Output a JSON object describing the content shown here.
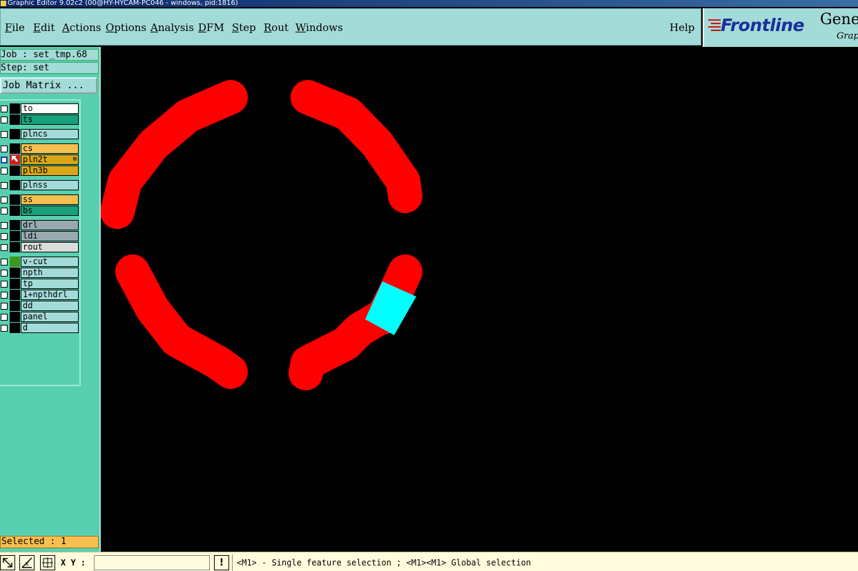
{
  "window": {
    "title": "Graphic Editor 9.02c2 (00@HY-HYCAM-PC046 - windows, pid:1816)"
  },
  "menubar": {
    "items": [
      {
        "key": "file",
        "label": "File",
        "u": "F",
        "rest": "ile"
      },
      {
        "key": "edit",
        "label": "Edit",
        "u": "E",
        "rest": "dit"
      },
      {
        "key": "actions",
        "label": "Actions",
        "u": "A",
        "rest": "ctions"
      },
      {
        "key": "options",
        "label": "Options",
        "u": "O",
        "rest": "ptions"
      },
      {
        "key": "analysis",
        "label": "Analysis",
        "u": "A",
        "rest": "nalysis"
      },
      {
        "key": "dfm",
        "label": "DFM",
        "u": "D",
        "rest": "FM"
      },
      {
        "key": "step",
        "label": "Step",
        "u": "S",
        "rest": "tep"
      },
      {
        "key": "rout",
        "label": "Rout",
        "u": "R",
        "rest": "out"
      },
      {
        "key": "windows",
        "label": "Windows",
        "u": "W",
        "rest": "indows"
      }
    ],
    "help": "Help"
  },
  "logo": {
    "brand": "Frontline",
    "product": "Genes",
    "sub": "Graphi"
  },
  "job": {
    "label": "Job : set_tmp.68"
  },
  "step": {
    "label": "Step: set"
  },
  "job_matrix_button": "Job Matrix ...",
  "layers": [
    {
      "name": "to",
      "color": "#ffffff",
      "status": "#000000",
      "active": false
    },
    {
      "name": "ts",
      "color": "#1aa07a",
      "status": "#000000",
      "active": false
    },
    {
      "name": "plncs",
      "color": "#a3dbd8",
      "status": "#000000",
      "active": false
    },
    {
      "name": "cs",
      "color": "#f6c050",
      "status": "#000000",
      "active": false
    },
    {
      "name": "pln2t",
      "color": "#d8a818",
      "status": "#cc2020",
      "active": true
    },
    {
      "name": "pln3b",
      "color": "#d8a818",
      "status": "#000000",
      "active": false
    },
    {
      "name": "plnss",
      "color": "#a3dbd8",
      "status": "#000000",
      "active": false
    },
    {
      "name": "ss",
      "color": "#f6c050",
      "status": "#000000",
      "active": false
    },
    {
      "name": "bs",
      "color": "#1aa07a",
      "status": "#000000",
      "active": false
    },
    {
      "name": "drl",
      "color": "#98aab0",
      "status": "#000000",
      "active": false
    },
    {
      "name": "ldi",
      "color": "#98aab0",
      "status": "#000000",
      "active": false
    },
    {
      "name": "rout",
      "color": "#dcdcdc",
      "status": "#000000",
      "active": false
    },
    {
      "name": "v-cut",
      "color": "#a3dbd8",
      "status": "#3a9a20",
      "active": false
    },
    {
      "name": "npth",
      "color": "#a3dbd8",
      "status": "#000000",
      "active": false
    },
    {
      "name": "tp",
      "color": "#a3dbd8",
      "status": "#000000",
      "active": false
    },
    {
      "name": "1+npthdrl",
      "color": "#a3dbd8",
      "status": "#000000",
      "active": false
    },
    {
      "name": "dd",
      "color": "#a3dbd8",
      "status": "#000000",
      "active": false
    },
    {
      "name": "panel",
      "color": "#a3dbd8",
      "status": "#000000",
      "active": false
    },
    {
      "name": "d",
      "color": "#a3dbd8",
      "status": "#000000",
      "active": false
    }
  ],
  "selected": {
    "label": "Selected : 1"
  },
  "statusbar": {
    "xy_label": "X Y :",
    "xy_value": "",
    "message": "<M1> - Single feature selection ; <M1><M1> Global selection"
  },
  "colors": {
    "feature": "#ff0000",
    "selected_feature": "#00ffff",
    "canvas": "#000000"
  }
}
